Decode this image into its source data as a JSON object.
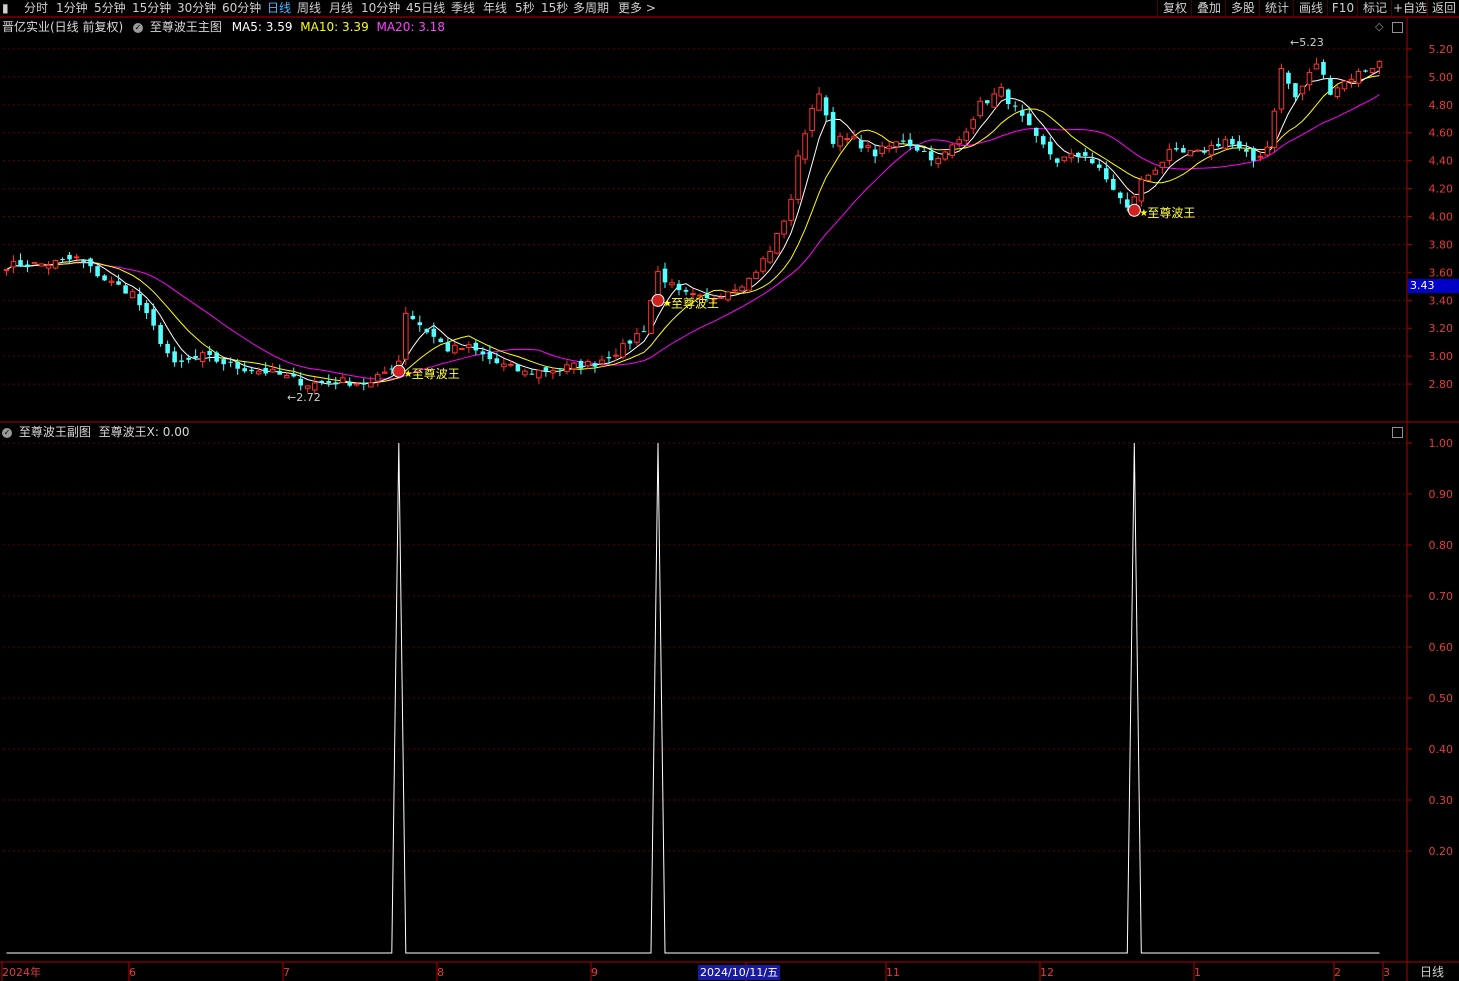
{
  "toolbar": {
    "periods": [
      "分时",
      "1分钟",
      "5分钟",
      "15分钟",
      "30分钟",
      "60分钟",
      "日线",
      "周线",
      "月线",
      "10分钟",
      "45日线",
      "季线",
      "年线",
      "5秒",
      "15秒",
      "多周期",
      "更多 >"
    ],
    "active": "日线",
    "right": [
      "复权",
      "叠加",
      "多股",
      "统计",
      "画线",
      "F10",
      "标记",
      "+自选",
      "返回"
    ]
  },
  "main_legend": {
    "stock": "晋亿实业(日线 前复权)",
    "indicator": "至尊波王主图",
    "ma5": "MA5: 3.59",
    "ma10": "MA10: 3.39",
    "ma20": "MA20: 3.18"
  },
  "sub_legend": {
    "indicator": "至尊波王副图",
    "value": "至尊波王X: 0.00"
  },
  "signal_label": "至尊波王",
  "price_tag": "3.43",
  "annotations": {
    "low": "2.72",
    "high": "5.23"
  },
  "x_axis": {
    "labels": [
      "2024年",
      "6",
      "7",
      "8",
      "9",
      "10",
      "11",
      "12",
      "1",
      "2",
      "3"
    ],
    "highlight": "2024/10/11/五",
    "period_label": "日线"
  },
  "colors": {
    "up": "#ff3232",
    "down": "#54ffff",
    "ma5": "#ffffff",
    "ma10": "#ffff00",
    "ma20": "#ff00ff",
    "grid": "#5a0000",
    "axis": "#b40000"
  },
  "chart_data": [
    {
      "type": "candlestick",
      "title": "晋亿实业(日线 前复权)",
      "ylim": [
        2.6,
        5.3
      ],
      "y_ticks": [
        2.8,
        3.0,
        3.2,
        3.4,
        3.6,
        3.8,
        4.0,
        4.2,
        4.4,
        4.6,
        4.8,
        5.0,
        5.2
      ],
      "x_labels": [
        "2024年",
        "6",
        "7",
        "8",
        "9",
        "10",
        "11",
        "12",
        "1",
        "2",
        "3"
      ],
      "series": [
        {
          "name": "MA5",
          "last": 3.59
        },
        {
          "name": "MA10",
          "last": 3.39
        },
        {
          "name": "MA20",
          "last": 3.18
        }
      ],
      "waypoints": [
        [
          0,
          3.65
        ],
        [
          6,
          3.66
        ],
        [
          10,
          3.7
        ],
        [
          14,
          3.55
        ],
        [
          18,
          3.45
        ],
        [
          21,
          3.2
        ],
        [
          24,
          2.93
        ],
        [
          28,
          3.0
        ],
        [
          33,
          2.92
        ],
        [
          38,
          2.88
        ],
        [
          43,
          2.8
        ],
        [
          48,
          2.82
        ],
        [
          52,
          2.8
        ],
        [
          56,
          2.97
        ],
        [
          57,
          3.32
        ],
        [
          60,
          3.18
        ],
        [
          63,
          3.05
        ],
        [
          66,
          3.06
        ],
        [
          70,
          2.95
        ],
        [
          74,
          2.88
        ],
        [
          80,
          2.92
        ],
        [
          84,
          2.95
        ],
        [
          88,
          3.06
        ],
        [
          91,
          3.2
        ],
        [
          93,
          3.6
        ],
        [
          96,
          3.45
        ],
        [
          100,
          3.4
        ],
        [
          106,
          3.55
        ],
        [
          109,
          3.75
        ],
        [
          112,
          4.1
        ],
        [
          113,
          4.45
        ],
        [
          116,
          4.9
        ],
        [
          118,
          4.55
        ],
        [
          121,
          4.55
        ],
        [
          124,
          4.45
        ],
        [
          128,
          4.55
        ],
        [
          133,
          4.4
        ],
        [
          136,
          4.55
        ],
        [
          139,
          4.8
        ],
        [
          142,
          4.9
        ],
        [
          145,
          4.7
        ],
        [
          147,
          4.55
        ],
        [
          150,
          4.4
        ],
        [
          154,
          4.45
        ],
        [
          158,
          4.2
        ],
        [
          160,
          4.05
        ],
        [
          162,
          4.25
        ],
        [
          166,
          4.45
        ],
        [
          170,
          4.45
        ],
        [
          174,
          4.55
        ],
        [
          178,
          4.4
        ],
        [
          180,
          4.5
        ],
        [
          182,
          5.05
        ],
        [
          184,
          4.85
        ],
        [
          187,
          5.1
        ],
        [
          189,
          4.9
        ],
        [
          192,
          5.0
        ],
        [
          196,
          5.1
        ]
      ],
      "count": 197,
      "signals": [
        56,
        93,
        161
      ],
      "annotations": [
        {
          "label": "2.72",
          "value": 2.72
        },
        {
          "label": "5.23",
          "value": 5.23
        }
      ]
    },
    {
      "type": "line",
      "title": "至尊波王副图",
      "series_name": "至尊波王X",
      "ylim": [
        0,
        1.0
      ],
      "y_ticks": [
        0.2,
        0.3,
        0.4,
        0.5,
        0.6,
        0.7,
        0.8,
        0.9,
        1.0
      ],
      "x_labels": [
        "2024年",
        "6",
        "7",
        "8",
        "9",
        "10",
        "11",
        "12",
        "1",
        "2",
        "3"
      ],
      "baseline": 0,
      "spikes": [
        {
          "index": 56,
          "value": 1.0
        },
        {
          "index": 93,
          "value": 1.0
        },
        {
          "index": 161,
          "value": 1.0
        }
      ],
      "count": 197
    }
  ]
}
